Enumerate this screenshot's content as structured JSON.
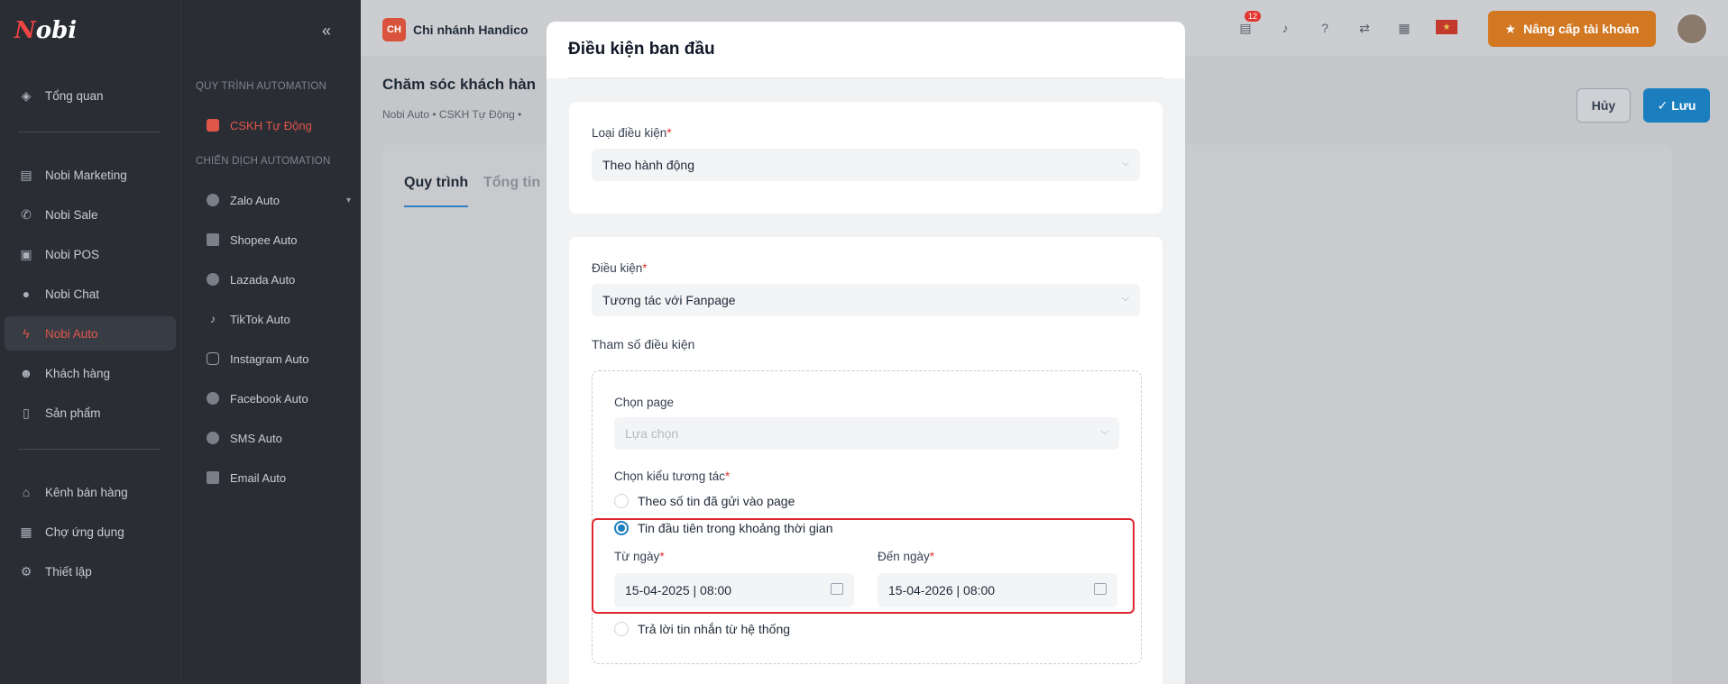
{
  "sidebar": {
    "logo": {
      "text": "Nobi"
    },
    "items": [
      {
        "label": "Tổng quan",
        "icon": "layers-icon"
      },
      {
        "label": "Nobi Marketing",
        "icon": "store-icon"
      },
      {
        "label": "Nobi Sale",
        "icon": "phone-icon"
      },
      {
        "label": "Nobi POS",
        "icon": "cash-icon"
      },
      {
        "label": "Nobi Chat",
        "icon": "chat-icon"
      },
      {
        "label": "Nobi Auto",
        "icon": "bolt-icon",
        "active": true
      },
      {
        "label": "Khách hàng",
        "icon": "users-icon"
      },
      {
        "label": "Sản phẩm",
        "icon": "file-icon"
      },
      {
        "label": "Kênh bán hàng",
        "icon": "shop-icon"
      },
      {
        "label": "Chợ ứng dụng",
        "icon": "apps-icon"
      },
      {
        "label": "Thiết lập",
        "icon": "gear-icon"
      }
    ]
  },
  "subbar": {
    "collapse_glyph": "«",
    "section1": "QUY TRÌNH AUTOMATION",
    "process_item": "CSKH Tự Động",
    "section2": "CHIẾN DỊCH AUTOMATION",
    "campaign_items": [
      "Zalo Auto",
      "Shopee Auto",
      "Lazada Auto",
      "TikTok Auto",
      "Instagram Auto",
      "Facebook Auto",
      "SMS Auto",
      "Email Auto"
    ]
  },
  "topbar": {
    "branch_badge": "CH",
    "branch_name": "Chi nhánh Handico",
    "notification_count": "12",
    "upgrade_label": "Nâng cấp tài khoản"
  },
  "page": {
    "title": "Chăm sóc khách hàn",
    "breadcrumb": "Nobi Auto  •  CSKH Tự Động  •",
    "tabs": [
      "Quy trình",
      "Tổng tin"
    ],
    "cancel_label": "Hủy",
    "save_label": "Lưu"
  },
  "modal": {
    "title": "Điều kiện ban đầu",
    "condition_type_label": "Loại điều kiện",
    "condition_type_value": "Theo hành động",
    "condition_label": "Điều kiện",
    "condition_value": "Tương tác với Fanpage",
    "params_title": "Tham số điều kiện",
    "page_label": "Chọn page",
    "page_placeholder": "Lựa chọn",
    "interaction_label": "Chọn kiểu tương tác",
    "options": [
      "Theo số tin đã gửi vào page",
      "Tin đầu tiên trong khoảng thời gian",
      "Trả lời tin nhắn từ hệ thống"
    ],
    "selected_option_index": 1,
    "from_label": "Từ ngày",
    "from_value": "15-04-2025 | 08:00",
    "to_label": "Đến ngày",
    "to_value": "15-04-2026 | 08:00",
    "required_mark": "*"
  },
  "colors": {
    "accent": "#1b7fbf",
    "brand_red": "#e0564a",
    "upgrade": "#d27722",
    "highlight": "#e0262e"
  }
}
